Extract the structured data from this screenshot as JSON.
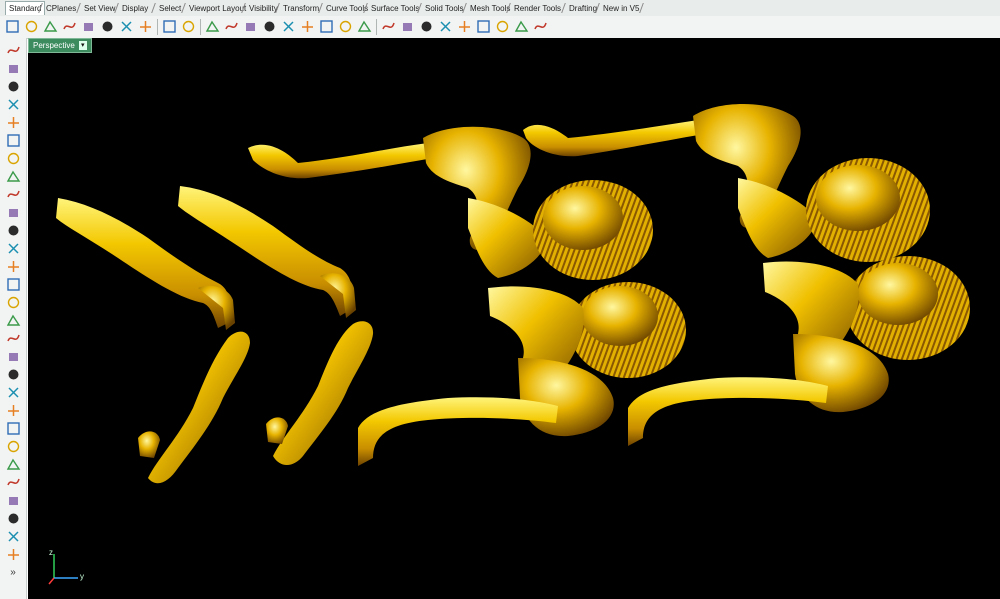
{
  "tabs": [
    "Standard",
    "CPlanes",
    "Set View",
    "Display",
    "Select",
    "Viewport Layout",
    "Visibility",
    "Transform",
    "Curve Tools",
    "Surface Tools",
    "Solid Tools",
    "Mesh Tools",
    "Render Tools",
    "Drafting",
    "New in V5"
  ],
  "active_tab": "Standard",
  "toolbar_icons": [
    "new-icon",
    "open-icon",
    "save-icon",
    "print-icon",
    "export-icon",
    "cut-icon",
    "copy-icon",
    "paste-icon",
    "undo-icon",
    "pan-icon",
    "rotate-view-icon",
    "zoom-icon",
    "zoom-window-icon",
    "zoom-extents-icon",
    "zoom-selected-icon",
    "undo-view-icon",
    "four-viewports-icon",
    "cplane-icon",
    "cplane-origin-icon",
    "named-views-icon",
    "light-icon",
    "layers-icon",
    "render-icon",
    "render-preview-icon",
    "material-icon",
    "environment-icon",
    "options-icon",
    "help-icon"
  ],
  "left_icons": [
    "select-icon",
    "point-icon",
    "polyline-icon",
    "curve-icon",
    "circle-icon",
    "ellipse-icon",
    "polygon-icon",
    "rectangle-icon",
    "arc-icon",
    "fillet-curve-icon",
    "offset-icon",
    "surface-icon",
    "box-icon",
    "sphere-icon",
    "extrude-icon",
    "mesh-icon",
    "boolean-icon",
    "light-bulb-icon",
    "dimension-icon",
    "blend-icon",
    "analyze-icon",
    "trim-icon",
    "split-icon",
    "join-icon",
    "text-icon",
    "group-icon",
    "block-icon",
    "transform-icon",
    "render-solid-icon",
    "more-icon"
  ],
  "viewport": {
    "title": "Perspective",
    "dropdown": "▾",
    "axis_x": "y",
    "axis_y": "z"
  },
  "colors": {
    "gold_light": "#fff06a",
    "gold_mid": "#e8b400",
    "gold_dark": "#8a5a00",
    "viewport_bg": "#000000",
    "title_bg": "#3b8b5f"
  }
}
